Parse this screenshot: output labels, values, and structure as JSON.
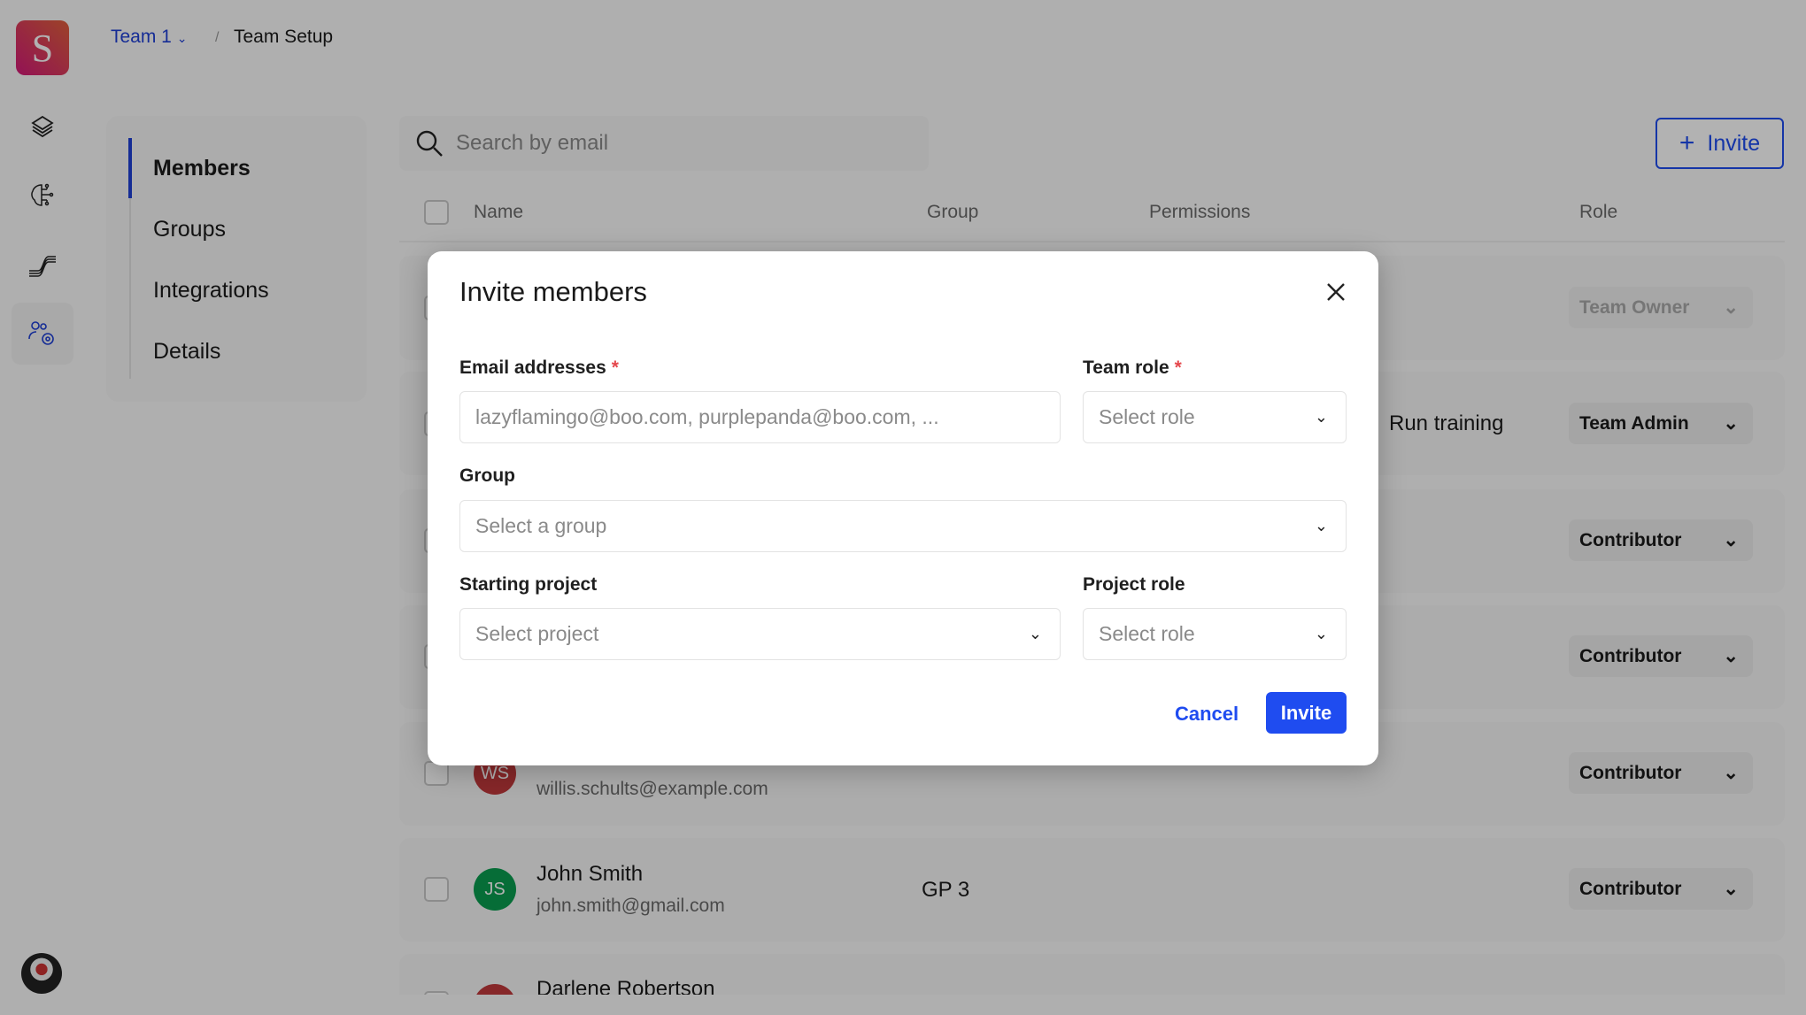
{
  "app": {
    "logo_letter": "S"
  },
  "breadcrumb": {
    "team": "Team 1",
    "page": "Team Setup"
  },
  "rail": {
    "icons": [
      "layers-icon",
      "brain-circuit-icon",
      "pipeline-icon",
      "team-settings-icon"
    ],
    "active": "team-settings-icon"
  },
  "subnav": {
    "items": [
      {
        "label": "Members"
      },
      {
        "label": "Groups"
      },
      {
        "label": "Integrations"
      },
      {
        "label": "Details"
      }
    ],
    "active": "Members"
  },
  "search": {
    "placeholder": "Search by email"
  },
  "toolbar": {
    "invite_label": "Invite"
  },
  "table": {
    "headers": {
      "name": "Name",
      "group": "Group",
      "permissions": "Permissions",
      "role": "Role"
    },
    "rows": [
      {
        "role": "Team Owner"
      },
      {
        "permissions": "Run training",
        "role": "Team Admin"
      },
      {
        "role": "Contributor"
      },
      {
        "role": "Contributor"
      },
      {
        "initials": "WS",
        "email": "willis.schults@example.com",
        "role": "Contributor",
        "avatar_color": "#c0393b"
      },
      {
        "initials": "JS",
        "name": "John Smith",
        "email": "john.smith@gmail.com",
        "group": "GP 3",
        "role": "Contributor",
        "avatar_color": "#0a9d4f"
      },
      {
        "name": "Darlene Robertson",
        "avatar_color": "#c0393b"
      }
    ]
  },
  "modal": {
    "title": "Invite members",
    "email_label": "Email addresses",
    "email_placeholder": "lazyflamingo@boo.com, purplepanda@boo.com, ...",
    "team_role_label": "Team role",
    "team_role_placeholder": "Select role",
    "group_label": "Group",
    "group_placeholder": "Select a group",
    "project_label": "Starting project",
    "project_placeholder": "Select project",
    "project_role_label": "Project role",
    "project_role_placeholder": "Select role",
    "required_mark": "*",
    "cancel": "Cancel",
    "invite": "Invite"
  },
  "colors": {
    "accent": "#1f4cf0",
    "required": "#e5484d"
  }
}
